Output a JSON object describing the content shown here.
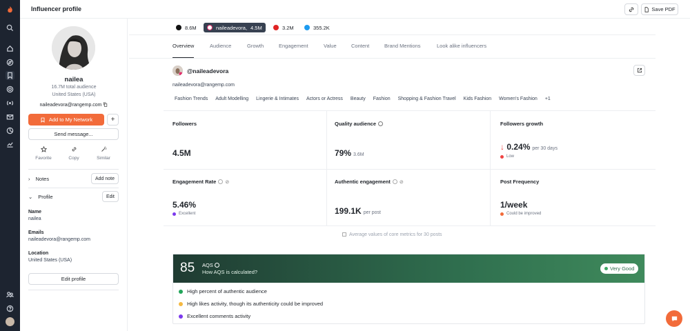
{
  "header": {
    "title": "Influencer profile",
    "save_pdf_label": "Save PDF"
  },
  "colors": {
    "accent": "#f26b3a",
    "rail": "#1d2430",
    "aqs_green": "#2f6e4e",
    "excellent": "#7c3aed",
    "low": "#ef4444",
    "warning": "#f59e0b"
  },
  "rail_icons": [
    "logo-icon",
    "search-icon",
    "home-icon",
    "discover-icon",
    "bookmark-icon",
    "target-icon",
    "broadcast-icon",
    "mail-icon",
    "analytics-icon",
    "trend-icon",
    "team-icon",
    "help-icon",
    "user-avatar"
  ],
  "profile": {
    "name": "nailea",
    "total_audience": "16.7M total audience",
    "location": "United States (USA)",
    "email": "naileadevora@rangemp.com",
    "add_network_label": "Add to My Network",
    "send_message_label": "Send message...",
    "actions": {
      "favorite": "Favorite",
      "copy": "Copy",
      "similar": "Similar"
    },
    "notes_label": "Notes",
    "add_note_label": "Add note",
    "profile_label": "Profile",
    "edit_label": "Edit",
    "fields": {
      "name_label": "Name",
      "name_value": "nailea",
      "emails_label": "Emails",
      "emails_value": "naileadevora@rangemp.com",
      "location_label": "Location",
      "location_value": "United States (USA)"
    },
    "edit_profile_label": "Edit profile"
  },
  "socials": [
    {
      "platform": "tiktok-icon",
      "value": "8.6M"
    },
    {
      "platform": "instagram-icon",
      "handle": "naileadevora,",
      "value": "4.5M"
    },
    {
      "platform": "youtube-icon",
      "value": "3.2M"
    },
    {
      "platform": "twitter-icon",
      "value": "355.2K"
    }
  ],
  "tabs": [
    "Overview",
    "Audience",
    "Growth",
    "Engagement",
    "Value",
    "Content",
    "Brand Mentions",
    "Look alike influencers"
  ],
  "account": {
    "handle": "@naileadevora",
    "email": "naileadevora@rangemp.com",
    "tags": [
      "Fashion Trends",
      "Adult Modelling",
      "Lingerie & Intimates",
      "Actors or Actress",
      "Beauty",
      "Fashion",
      "Shopping & Fashion Travel",
      "Kids Fashion",
      "Women's Fashion",
      "+1"
    ]
  },
  "metrics": {
    "followers": {
      "title": "Followers",
      "value": "4.5M"
    },
    "quality": {
      "title": "Quality audience",
      "value": "79%",
      "sub": "3.6M"
    },
    "growth": {
      "title": "Followers growth",
      "value": "0.24%",
      "unit": "per 30 days",
      "status": "Low"
    },
    "engagement_rate": {
      "title": "Engagement Rate",
      "value": "5.46%",
      "status": "Excellent"
    },
    "authentic": {
      "title": "Authentic engagement",
      "value": "199.1K",
      "unit": "per post"
    },
    "post_freq": {
      "title": "Post Frequency",
      "value": "1/week",
      "status": "Could be improved"
    },
    "avg_note": "Average values of core metrics for 30 posts"
  },
  "aqs": {
    "score": "85",
    "label": "AQS",
    "how": "How AQS is calculated?",
    "badge": "Very Good",
    "items": [
      {
        "text": "High percent of authentic audience",
        "color": "#22a55a"
      },
      {
        "text": "High likes activity, though its authenticity could be improved",
        "color": "#f5b942"
      },
      {
        "text": "Excellent comments activity",
        "color": "#7c3aed"
      }
    ]
  }
}
